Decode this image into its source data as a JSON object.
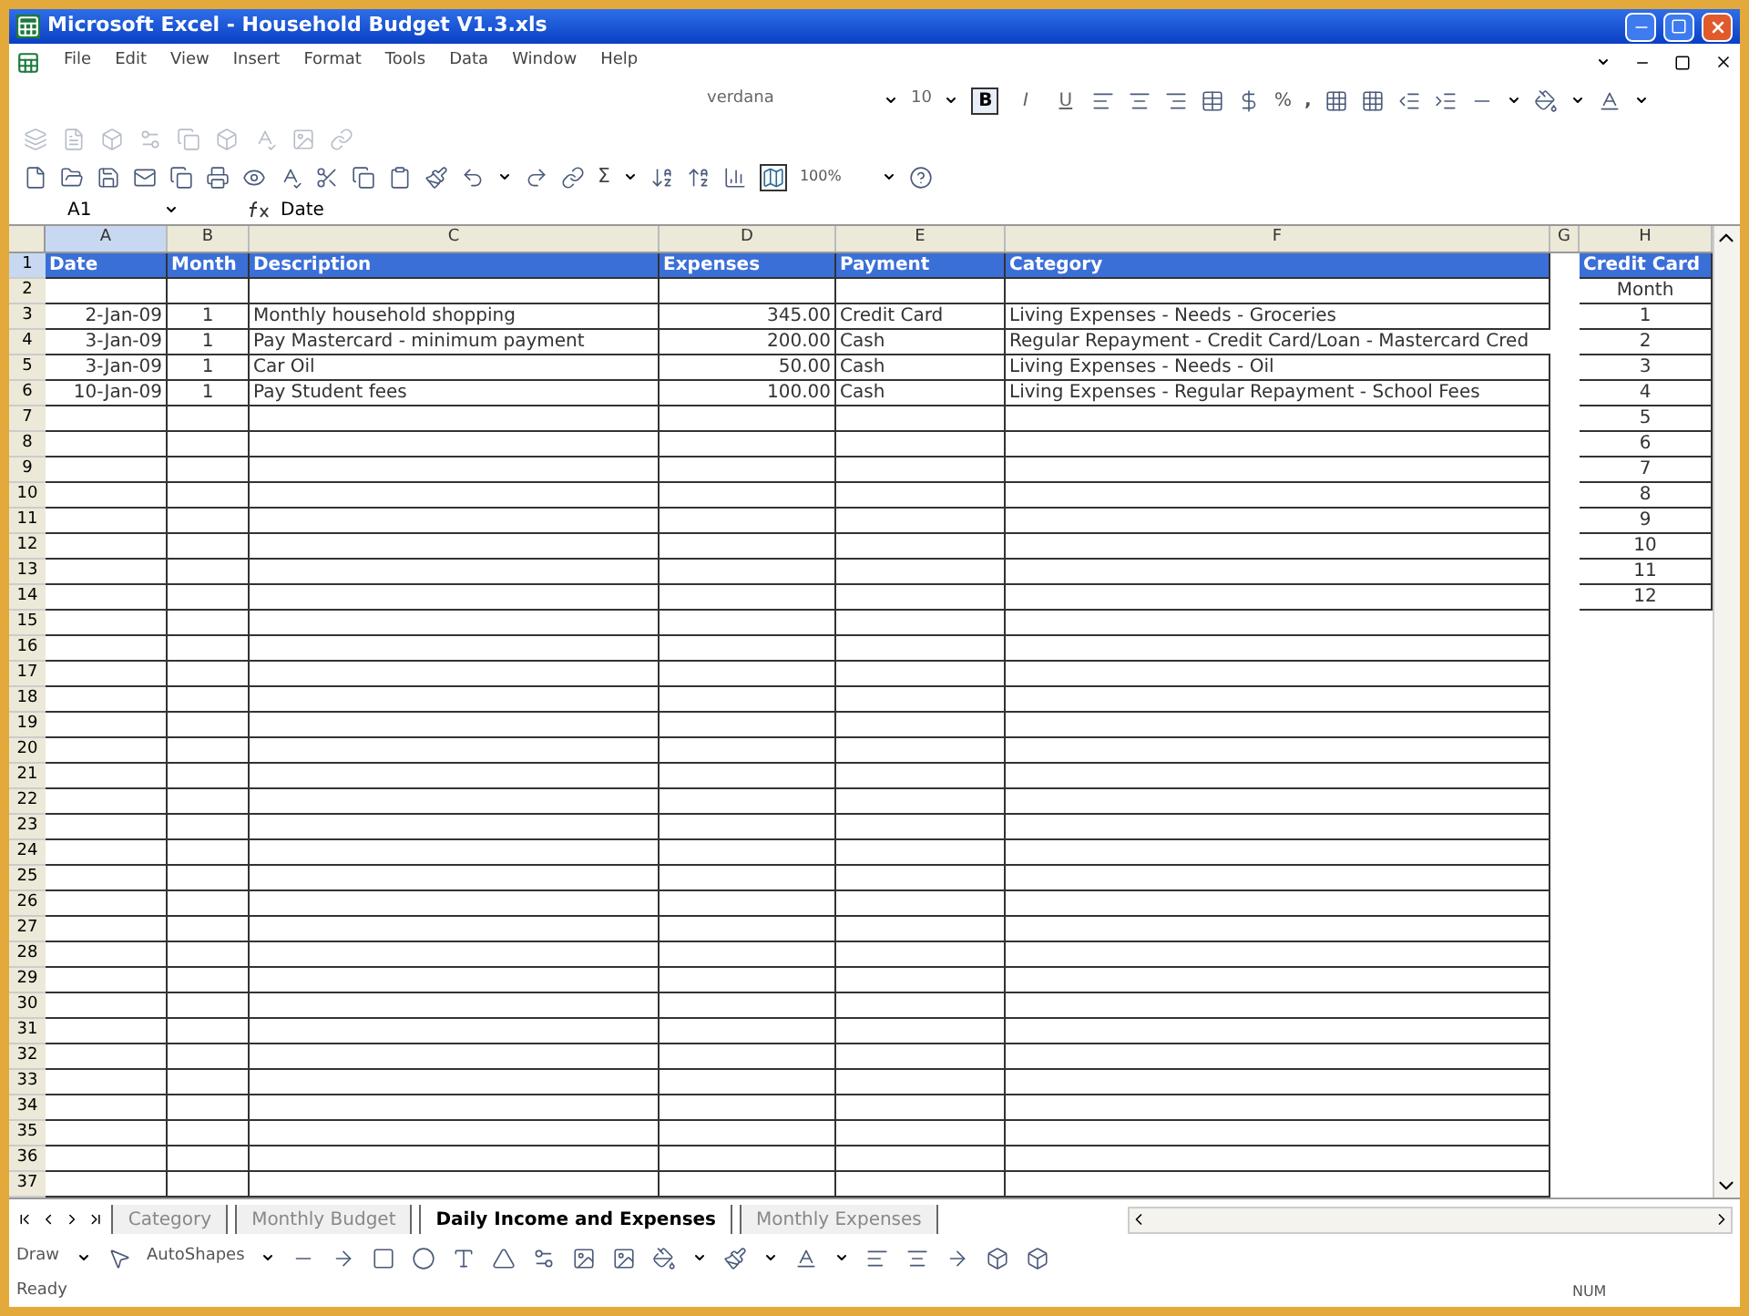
{
  "window": {
    "title": "Microsoft Excel - Household Budget V1.3.xls"
  },
  "menu": [
    "File",
    "Edit",
    "View",
    "Insert",
    "Format",
    "Tools",
    "Data",
    "Window",
    "Help"
  ],
  "format_toolbar": {
    "font": "verdana",
    "size": "10",
    "style_buttons": [
      {
        "label": "B",
        "selected": true
      },
      {
        "label": "I",
        "selected": false
      },
      {
        "label": "U",
        "selected": false
      }
    ],
    "percent": "%",
    "comma": ","
  },
  "standard_toolbar": {
    "sum": "Σ",
    "zoom": "100%"
  },
  "formula_bar": {
    "name_box": "A1",
    "content": "Date"
  },
  "columns": [
    {
      "label": "A",
      "selected": true
    },
    {
      "label": "B",
      "selected": false
    },
    {
      "label": "C",
      "selected": false
    },
    {
      "label": "D",
      "selected": false
    },
    {
      "label": "E",
      "selected": false
    },
    {
      "label": "F",
      "selected": false
    },
    {
      "label": "G",
      "selected": false
    },
    {
      "label": "H",
      "selected": false
    }
  ],
  "rows": [
    {
      "number": "1",
      "selected": true,
      "kind": "header",
      "cells": {
        "A": "Date",
        "B": "Month",
        "C": "Description",
        "D": "Expenses",
        "E": "Payment",
        "F": "Category",
        "H": "Credit Card"
      }
    },
    {
      "number": "2",
      "selected": false,
      "kind": "data",
      "cells": {
        "H": "Month"
      }
    },
    {
      "number": "3",
      "selected": false,
      "kind": "data",
      "cells": {
        "A": "2-Jan-09",
        "B": "1",
        "C": "Monthly household shopping",
        "D": "345.00",
        "E": "Credit Card",
        "F": "Living Expenses - Needs - Groceries",
        "H": "1"
      }
    },
    {
      "number": "4",
      "selected": false,
      "kind": "data",
      "cells": {
        "A": "3-Jan-09",
        "B": "1",
        "C": "Pay Mastercard - minimum payment",
        "D": "200.00",
        "E": "Cash",
        "F": "Regular Repayment - Credit Card/Loan - Mastercard Cred",
        "H": "2"
      }
    },
    {
      "number": "5",
      "selected": false,
      "kind": "data",
      "cells": {
        "A": "3-Jan-09",
        "B": "1",
        "C": "Car Oil",
        "D": "50.00",
        "E": "Cash",
        "F": "Living Expenses - Needs - Oil",
        "H": "3"
      }
    },
    {
      "number": "6",
      "selected": false,
      "kind": "data",
      "cells": {
        "A": "10-Jan-09",
        "B": "1",
        "C": "Pay Student fees",
        "D": "100.00",
        "E": "Cash",
        "F": "Living Expenses - Regular Repayment - School Fees",
        "H": "4"
      }
    },
    {
      "number": "7",
      "selected": false,
      "kind": "data",
      "cells": {
        "H": "5"
      }
    },
    {
      "number": "8",
      "selected": false,
      "kind": "data",
      "cells": {
        "H": "6"
      }
    },
    {
      "number": "9",
      "selected": false,
      "kind": "data",
      "cells": {
        "H": "7"
      }
    },
    {
      "number": "10",
      "selected": false,
      "kind": "data",
      "cells": {
        "H": "8"
      }
    },
    {
      "number": "11",
      "selected": false,
      "kind": "data",
      "cells": {
        "H": "9"
      }
    },
    {
      "number": "12",
      "selected": false,
      "kind": "data",
      "cells": {
        "H": "10"
      }
    },
    {
      "number": "13",
      "selected": false,
      "kind": "data",
      "cells": {
        "H": "11"
      }
    },
    {
      "number": "14",
      "selected": false,
      "kind": "data",
      "cells": {
        "H": "12"
      }
    },
    {
      "number": "15",
      "selected": false,
      "kind": "data",
      "cells": {}
    },
    {
      "number": "16",
      "selected": false,
      "kind": "data",
      "cells": {}
    },
    {
      "number": "17",
      "selected": false,
      "kind": "data",
      "cells": {}
    },
    {
      "number": "18",
      "selected": false,
      "kind": "data",
      "cells": {}
    },
    {
      "number": "19",
      "selected": false,
      "kind": "data",
      "cells": {}
    },
    {
      "number": "20",
      "selected": false,
      "kind": "data",
      "cells": {}
    },
    {
      "number": "21",
      "selected": false,
      "kind": "data",
      "cells": {}
    },
    {
      "number": "22",
      "selected": false,
      "kind": "data",
      "cells": {}
    },
    {
      "number": "23",
      "selected": false,
      "kind": "data",
      "cells": {}
    },
    {
      "number": "24",
      "selected": false,
      "kind": "data",
      "cells": {}
    },
    {
      "number": "25",
      "selected": false,
      "kind": "data",
      "cells": {}
    },
    {
      "number": "26",
      "selected": false,
      "kind": "data",
      "cells": {}
    },
    {
      "number": "27",
      "selected": false,
      "kind": "data",
      "cells": {}
    },
    {
      "number": "28",
      "selected": false,
      "kind": "data",
      "cells": {}
    },
    {
      "number": "29",
      "selected": false,
      "kind": "data",
      "cells": {}
    },
    {
      "number": "30",
      "selected": false,
      "kind": "data",
      "cells": {}
    },
    {
      "number": "31",
      "selected": false,
      "kind": "data",
      "cells": {}
    },
    {
      "number": "32",
      "selected": false,
      "kind": "data",
      "cells": {}
    },
    {
      "number": "33",
      "selected": false,
      "kind": "data",
      "cells": {}
    },
    {
      "number": "34",
      "selected": false,
      "kind": "data",
      "cells": {}
    },
    {
      "number": "35",
      "selected": false,
      "kind": "data",
      "cells": {}
    },
    {
      "number": "36",
      "selected": false,
      "kind": "data",
      "cells": {}
    },
    {
      "number": "37",
      "selected": false,
      "kind": "data",
      "cells": {}
    }
  ],
  "sheet_tabs": [
    {
      "label": "Category",
      "selected": false
    },
    {
      "label": "Monthly Budget",
      "selected": false
    },
    {
      "label": "Daily Income and Expenses",
      "selected": true
    },
    {
      "label": "Monthly Expenses",
      "selected": false
    }
  ],
  "draw_toolbar": {
    "draw": "Draw",
    "autoshapes": "AutoShapes"
  },
  "status_bar": {
    "status": "Ready",
    "num": "NUM"
  }
}
